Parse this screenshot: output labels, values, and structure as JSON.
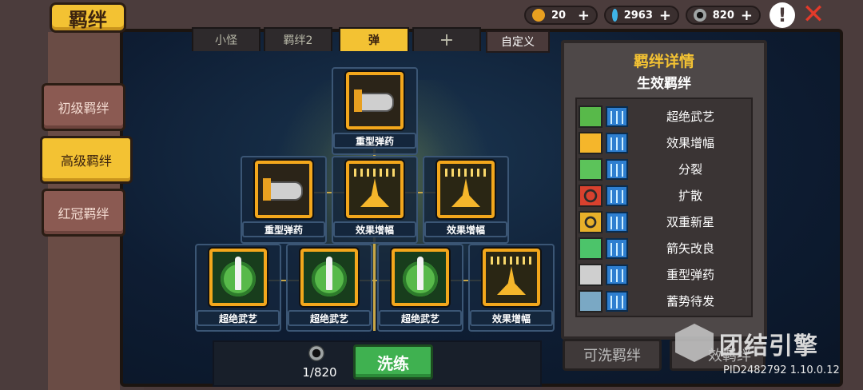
{
  "header": {
    "title": "羁绊",
    "resources": [
      {
        "name": "ticket",
        "icon": "ticket-icon",
        "value": "20",
        "color": "#e8a020"
      },
      {
        "name": "gem",
        "icon": "gem-icon",
        "value": "2963",
        "color": "#3fb4e8"
      },
      {
        "name": "gear",
        "icon": "gear-coin-icon",
        "value": "820",
        "color": "#9fa4a4"
      }
    ],
    "plus_label": "+",
    "alert_label": "!",
    "close_label": "✕"
  },
  "sidebar": {
    "items": [
      {
        "label": "初级羁绊",
        "active": false
      },
      {
        "label": "高级羁绊",
        "active": true
      },
      {
        "label": "红冠羁绊",
        "active": false
      }
    ]
  },
  "tabs": {
    "items": [
      {
        "label": "小怪",
        "active": false
      },
      {
        "label": "羁绊2",
        "active": false
      },
      {
        "label": "弹",
        "active": true
      },
      {
        "label": "+",
        "active": false
      }
    ],
    "custom_label": "自定义"
  },
  "tree": {
    "nodes": [
      {
        "label": "重型弹药",
        "icon": "bullet"
      },
      {
        "label": "重型弹药",
        "icon": "bullet"
      },
      {
        "label": "效果增幅",
        "icon": "hands"
      },
      {
        "label": "效果增幅",
        "icon": "hands"
      },
      {
        "label": "超绝武艺",
        "icon": "sword"
      },
      {
        "label": "超绝武艺",
        "icon": "sword"
      },
      {
        "label": "超绝武艺",
        "icon": "sword"
      },
      {
        "label": "效果增幅",
        "icon": "hands"
      }
    ]
  },
  "details": {
    "title": "羁绊详情",
    "subtitle": "生效羁绊",
    "bonds": [
      {
        "name": "超绝武艺",
        "icon": "sword-icon",
        "color": "#58b94a"
      },
      {
        "name": "效果增幅",
        "icon": "hands-icon",
        "color": "#f5b62b"
      },
      {
        "name": "分裂",
        "icon": "split-icon",
        "color": "#5cc35a"
      },
      {
        "name": "扩散",
        "icon": "spread-icon",
        "color": "#d8412e"
      },
      {
        "name": "双重新星",
        "icon": "nova-icon",
        "color": "#e8b02a"
      },
      {
        "name": "箭矢改良",
        "icon": "arrow-icon",
        "color": "#4cc46a"
      },
      {
        "name": "重型弹药",
        "icon": "bullet-icon",
        "color": "#cfcfcf"
      },
      {
        "name": "蓄势待发",
        "icon": "charge-icon",
        "color": "#7aa8c4"
      }
    ]
  },
  "bottom": {
    "cost_text": "1/820",
    "wash_label": "洗练",
    "tab_left": "可洗羁绊",
    "tab_right": "效羁绊"
  },
  "watermark": {
    "text": "团结引擎",
    "build": "PID2482792 1.10.0.12"
  }
}
